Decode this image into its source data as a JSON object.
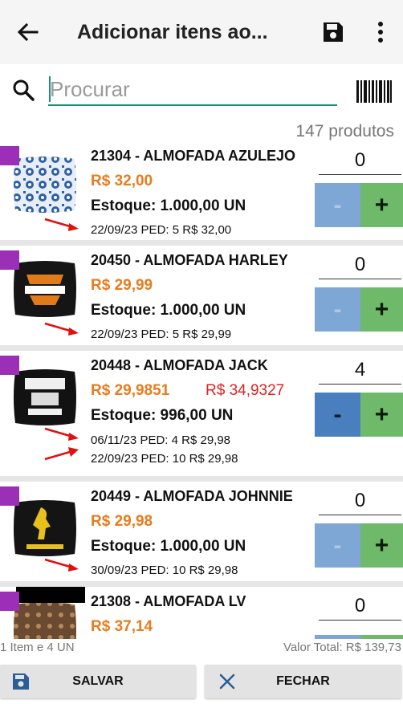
{
  "appbar": {
    "title": "Adicionar itens ao...",
    "back_icon": "arrow-left-icon",
    "save_icon": "floppy-disk-icon",
    "more_icon": "more-vert-icon"
  },
  "search": {
    "placeholder": "Procurar",
    "value": "",
    "barcode_icon": "barcode-icon"
  },
  "product_count": "147 produtos",
  "products": [
    {
      "name": "21304 - ALMOFADA AZULEJO",
      "price": "R$ 32,00",
      "alt_price": "",
      "stock": "Estoque:  1.000,00 UN",
      "orders": [
        "22/09/23 PED: 5 R$ 32,00"
      ],
      "quantity": "0",
      "minus_label": "-",
      "plus_label": "+"
    },
    {
      "name": "20450 - ALMOFADA HARLEY",
      "price": "R$ 29,99",
      "alt_price": "",
      "stock": "Estoque:  1.000,00 UN",
      "orders": [
        "22/09/23 PED: 5 R$ 29,99"
      ],
      "quantity": "0",
      "minus_label": "-",
      "plus_label": "+"
    },
    {
      "name": "20448 - ALMOFADA JACK",
      "price": "R$ 29,9851",
      "alt_price": "R$ 34,9327",
      "stock": "Estoque:  996,00 UN",
      "orders": [
        "06/11/23 PED: 4 R$ 29,98",
        "22/09/23 PED: 10 R$ 29,98"
      ],
      "quantity": "4",
      "minus_label": "-",
      "plus_label": "+"
    },
    {
      "name": "20449 - ALMOFADA JOHNNIE",
      "price": "R$ 29,98",
      "alt_price": "",
      "stock": "Estoque:  1.000,00 UN",
      "orders": [
        "30/09/23 PED: 10 R$ 29,98"
      ],
      "quantity": "0",
      "minus_label": "-",
      "plus_label": "+"
    },
    {
      "name": "21308 - ALMOFADA LV",
      "price": "R$ 37,14",
      "alt_price": "",
      "stock": "",
      "orders": [],
      "quantity": "0",
      "minus_label": "-",
      "plus_label": "+"
    }
  ],
  "footer": {
    "summary": "1 Item e 4 UN",
    "total": "Valor Total: R$ 139,73",
    "save_label": "SALVAR",
    "close_label": "FECHAR"
  },
  "colors": {
    "accent": "#1a8f7c",
    "price": "#e87c1e",
    "alt_price": "#e02020",
    "tag": "#9b2fb5",
    "minus": "#7ea7d6",
    "minus_active": "#4a7fbf",
    "plus": "#6fba6a"
  }
}
